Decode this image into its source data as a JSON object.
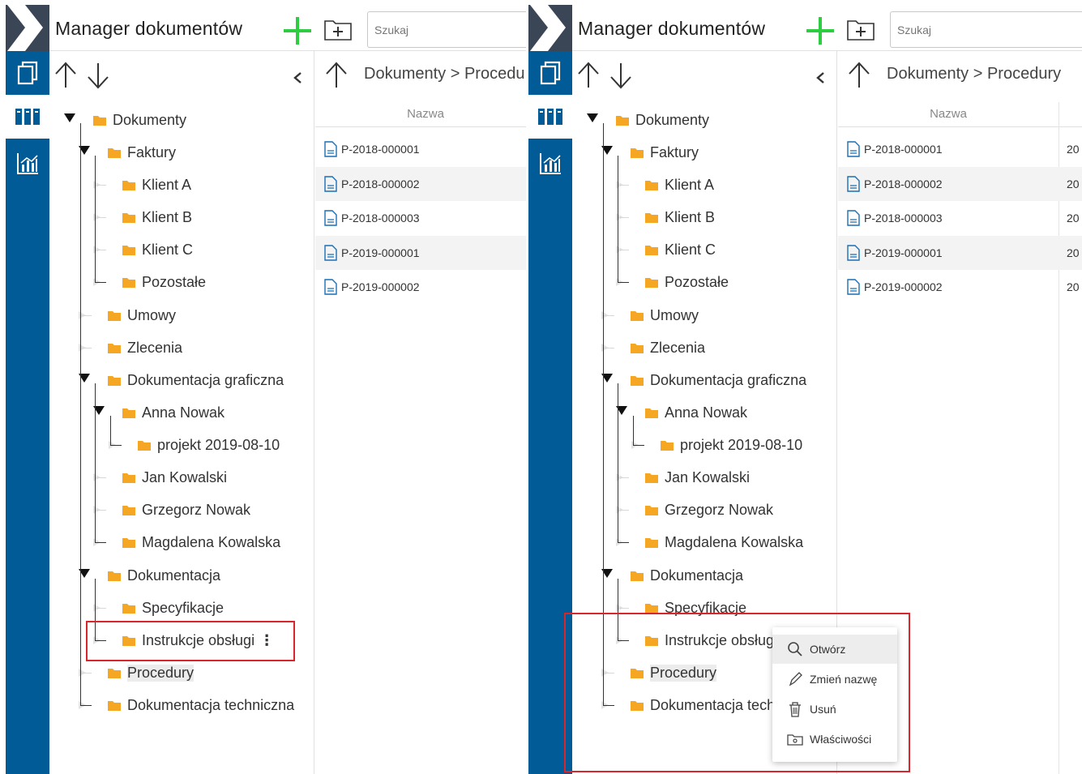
{
  "app": {
    "title": "Manager dokumentów",
    "search_placeholder": "Szukaj"
  },
  "tree": {
    "nodes": [
      {
        "label": "Dokumenty"
      },
      {
        "label": "Faktury"
      },
      {
        "label": "Klient A"
      },
      {
        "label": "Klient B"
      },
      {
        "label": "Klient C"
      },
      {
        "label": "Pozostałe"
      },
      {
        "label": "Umowy"
      },
      {
        "label": "Zlecenia"
      },
      {
        "label": "Dokumentacja graficzna"
      },
      {
        "label": "Anna Nowak"
      },
      {
        "label": "projekt 2019-08-10"
      },
      {
        "label": "Jan Kowalski"
      },
      {
        "label": "Grzegorz Nowak"
      },
      {
        "label": "Magdalena Kowalska"
      },
      {
        "label": "Dokumentacja"
      },
      {
        "label": "Specyfikacje"
      },
      {
        "label": "Instrukcje obsługi"
      },
      {
        "label": "Procedury"
      },
      {
        "label": "Dokumentacja techniczna"
      }
    ],
    "more_glyph": "⋮"
  },
  "breadcrumb": {
    "left": "Dokumenty > Procedu",
    "right": "Dokumenty > Procedury"
  },
  "files": {
    "column_name": "Nazwa",
    "date_clip": "20",
    "rows": [
      {
        "name": "P-2018-000001"
      },
      {
        "name": "P-2018-000002"
      },
      {
        "name": "P-2018-000003"
      },
      {
        "name": "P-2019-000001"
      },
      {
        "name": "P-2019-000002"
      }
    ]
  },
  "context_menu": {
    "items": [
      {
        "label": "Otwórz"
      },
      {
        "label": "Zmień nazwę"
      },
      {
        "label": "Usuń"
      },
      {
        "label": "Właściwości"
      }
    ]
  },
  "right_tree_clipped": {
    "instrukcje": "Instrukcje obsługi",
    "dok_tech": "Dokumentacja tech"
  },
  "colors": {
    "sidebar": "#005b96",
    "logo": "#3a4655",
    "accent_green": "#2ecc40",
    "folder": "#f5a623",
    "highlight_red": "#d9262c"
  }
}
